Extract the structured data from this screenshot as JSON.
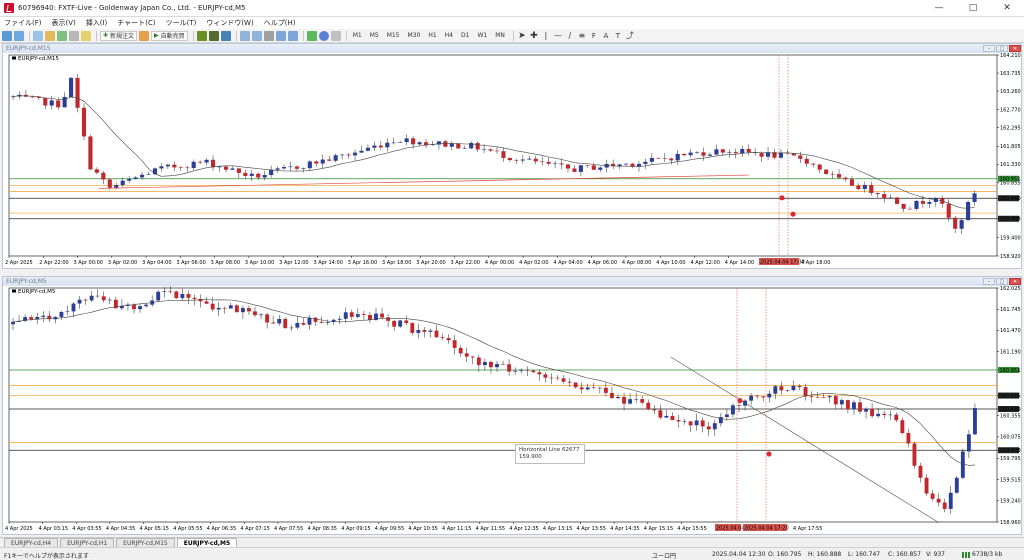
{
  "window": {
    "title": "60796940: FXTF-Live - Goldenway Japan Co., Ltd. - EURJPY-cd,M5"
  },
  "menu": {
    "items": [
      "ファイル(F)",
      "表示(V)",
      "挿入(I)",
      "チャート(C)",
      "ツール(T)",
      "ウィンドウ(W)",
      "ヘルプ(H)"
    ]
  },
  "toolbar": {
    "new_order": "新規注文",
    "auto_trading": "自動売買",
    "timeframes": [
      "M1",
      "M5",
      "M15",
      "M30",
      "H1",
      "H4",
      "D1",
      "W1",
      "MN"
    ]
  },
  "chart_data": [
    {
      "type": "candlestick",
      "title": "EURJPY-cd,M15",
      "symbol_label": "EURJPY-cd,M15",
      "y_ticks": [
        "164.210",
        "163.735",
        "163.260",
        "162.770",
        "162.295",
        "161.805",
        "161.330",
        "160.855",
        "160.440",
        "159.900",
        "159.400",
        "158.920"
      ],
      "price_labels": [
        {
          "value": "160.953",
          "color": "#2e8b2e"
        },
        {
          "value": "160.440",
          "color": "#222222"
        },
        {
          "value": "159.900",
          "color": "#222222"
        }
      ],
      "x_ticks": [
        "2 Apr 2025",
        "2 Apr 22:00",
        "3 Apr 00:00",
        "3 Apr 02:00",
        "3 Apr 04:00",
        "3 Apr 06:00",
        "3 Apr 08:00",
        "3 Apr 10:00",
        "3 Apr 12:00",
        "3 Apr 14:00",
        "3 Apr 16:00",
        "3 Apr 18:00",
        "3 Apr 20:00",
        "3 Apr 22:00",
        "4 Apr 00:00",
        "4 Apr 02:00",
        "4 Apr 04:00",
        "4 Apr 06:00",
        "4 Apr 08:00",
        "4 Apr 10:00",
        "4 Apr 12:00",
        "4 Apr 14:00"
      ],
      "x_highlight": "2025.04.04 17:00",
      "x_last": "4 Apr 18:00",
      "ylim": [
        158.92,
        164.21
      ],
      "horizontal_lines": [
        {
          "value": 160.953,
          "color": "#2e8b2e"
        },
        {
          "value": 160.78,
          "color": "#f0a030"
        },
        {
          "value": 160.62,
          "color": "#f0a030"
        },
        {
          "value": 160.44,
          "color": "#222222"
        },
        {
          "value": 160.05,
          "color": "#f0a030"
        },
        {
          "value": 159.9,
          "color": "#222222"
        }
      ]
    },
    {
      "type": "candlestick",
      "title": "EURJPY-cd,M5",
      "symbol_label": "EURJPY-cd,M5",
      "y_ticks": [
        "162.025",
        "161.745",
        "161.470",
        "161.190",
        "160.951",
        "160.616",
        "160.440",
        "160.355",
        "160.075",
        "159.900",
        "159.795",
        "159.515",
        "159.240",
        "158.960"
      ],
      "price_labels": [
        {
          "value": "160.951",
          "color": "#2e8b2e"
        },
        {
          "value": "160.616",
          "color": "#222222"
        },
        {
          "value": "160.440",
          "color": "#222222"
        },
        {
          "value": "159.900",
          "color": "#222222"
        }
      ],
      "x_ticks": [
        "4 Apr 2025",
        "4 Apr 03:15",
        "4 Apr 03:55",
        "4 Apr 04:35",
        "4 Apr 05:15",
        "4 Apr 05:55",
        "4 Apr 06:35",
        "4 Apr 07:15",
        "4 Apr 07:55",
        "4 Apr 08:35",
        "4 Apr 09:15",
        "4 Apr 09:55",
        "4 Apr 10:35",
        "4 Apr 11:15",
        "4 Apr 11:55",
        "4 Apr 12:35",
        "4 Apr 13:15",
        "4 Apr 13:55",
        "4 Apr 14:35",
        "4 Apr 15:15",
        "4 Apr 15:55"
      ],
      "x_highlights": [
        "2025.04.04",
        "2025.04.04 17:20"
      ],
      "x_last": "4 Apr 17:55",
      "ylim": [
        158.96,
        162.025
      ],
      "horizontal_lines": [
        {
          "value": 160.951,
          "color": "#2e8b2e"
        },
        {
          "value": 160.75,
          "color": "#f0a030"
        },
        {
          "value": 160.616,
          "color": "#f0a030"
        },
        {
          "value": 160.44,
          "color": "#222222"
        },
        {
          "value": 160.0,
          "color": "#f0a030"
        },
        {
          "value": 159.9,
          "color": "#222222"
        }
      ],
      "tooltip": {
        "line1": "Horizontal Line 62677",
        "line2": "159.900"
      }
    }
  ],
  "tabs": [
    "EURJPY-cd,H4",
    "EURJPY-cd,H1",
    "EURJPY-cd,M15",
    "EURJPY-cd,M5"
  ],
  "active_tab": 3,
  "status": {
    "help": "F1キーでヘルプが表示されます",
    "profile": "ユーロ円",
    "datetime": "2025.04.04 12:30",
    "open": "O: 160.795",
    "high": "H: 160.888",
    "low": "L: 160.747",
    "close": "C: 160.857",
    "volume": "V: 937",
    "traffic": "6738/3 kb"
  },
  "colors": {
    "bull": "#2b3f99",
    "bear": "#c0282d",
    "ma": "#444444",
    "red_line": "#e04b3a"
  }
}
